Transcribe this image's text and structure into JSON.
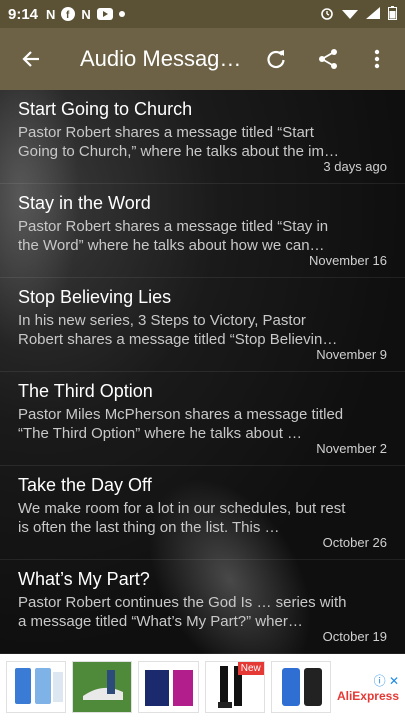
{
  "status": {
    "time": "9:14",
    "left_icons": [
      "N",
      "f",
      "N",
      "yt"
    ]
  },
  "appbar": {
    "title": "Audio Messag…",
    "back_icon": "arrow-left-icon",
    "refresh_icon": "refresh-icon",
    "share_icon": "share-icon",
    "more_icon": "more-vert-icon"
  },
  "items": [
    {
      "title": "Start Going to Church",
      "desc": "Pastor Robert shares a message titled “Start Going to Church,” where he talks about the im…",
      "date": "3 days ago"
    },
    {
      "title": "Stay in the Word",
      "desc": "Pastor Robert shares a message titled “Stay in the Word” where he talks about how we can…",
      "date": "November 16"
    },
    {
      "title": "Stop Believing Lies",
      "desc": "In his new series, 3 Steps to Victory, Pastor Robert shares a message titled “Stop Believin…",
      "date": "November 9"
    },
    {
      "title": "The Third Option",
      "desc": "Pastor Miles McPherson shares a message titled “The Third Option” where he talks about …",
      "date": "November 2"
    },
    {
      "title": "Take the Day Off",
      "desc": "We make room for a lot in our schedules, but rest is often the last thing on the list. This …",
      "date": "October 26"
    },
    {
      "title": "What’s My Part?",
      "desc": "Pastor Robert continues the God Is … series with a message titled “What’s My Part?” wher…",
      "date": "October 19"
    }
  ],
  "ad": {
    "new_badge": "New",
    "brand": "AliExpress",
    "colors": {
      "brand": "#e53935",
      "info": "#1e88e5"
    }
  }
}
